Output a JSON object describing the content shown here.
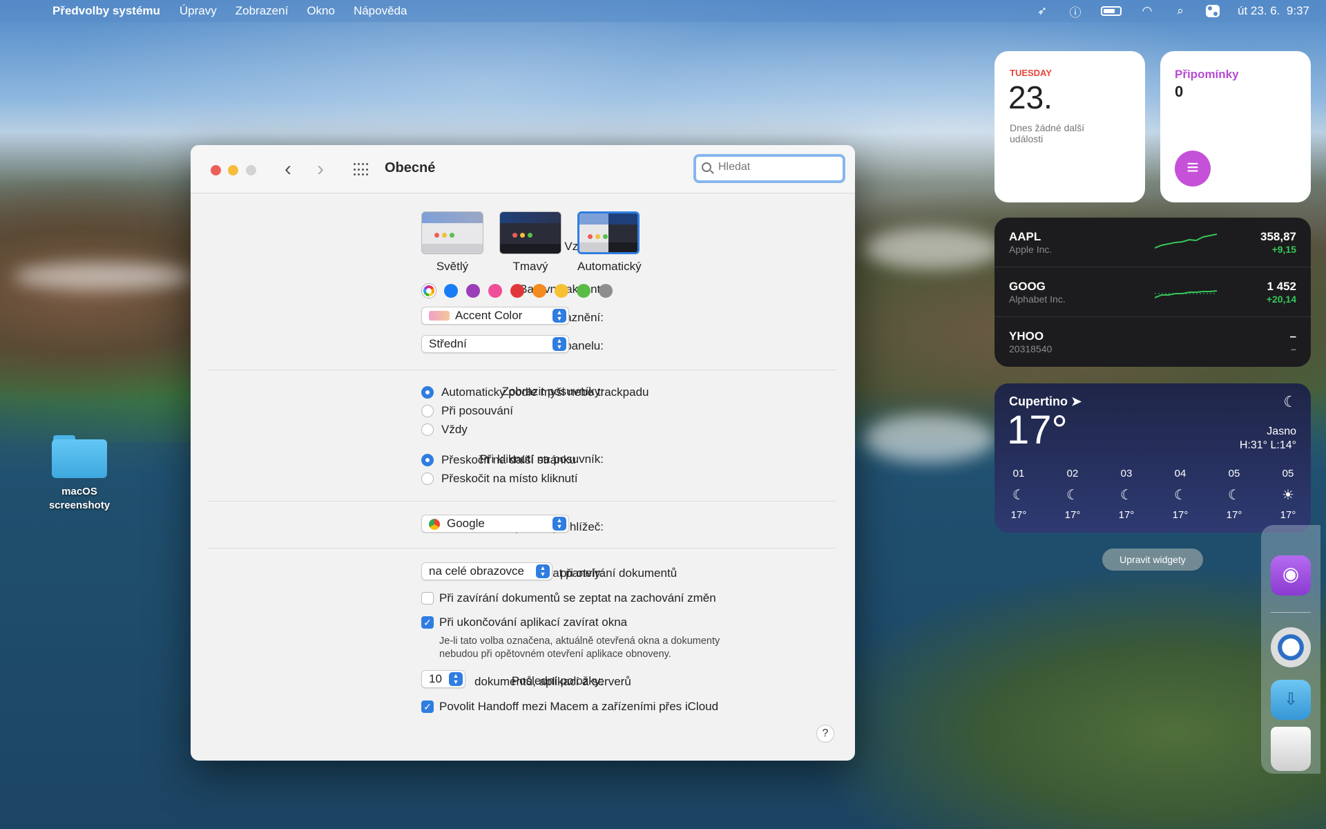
{
  "menubar": {
    "app": "Předvolby systému",
    "items": [
      "Úpravy",
      "Zobrazení",
      "Okno",
      "Nápověda"
    ],
    "datetime": "út 23. 6.  9:37"
  },
  "desktop": {
    "folder_label": "macOS screenshoty"
  },
  "window": {
    "title": "Obecné",
    "search_placeholder": "Hledat",
    "appearance": {
      "label": "Vzhled:",
      "options": [
        "Světlý",
        "Tmavý",
        "Automatický"
      ],
      "selected": "Automatický"
    },
    "accent": {
      "label": "Barevný akcent:",
      "colors": [
        "multicolor",
        "#1a7cf5",
        "#9b3fb8",
        "#f04e98",
        "#e2373a",
        "#f58a1f",
        "#f7c133",
        "#5bbb47",
        "#8e8e8e"
      ]
    },
    "highlight": {
      "label": "Barva zvýraznění:",
      "value": "Accent Color"
    },
    "sidebar_icons": {
      "label": "Velikost ikon na bočním panelu:",
      "value": "Střední"
    },
    "scrollbars": {
      "label": "Zobrazit posuvníky:",
      "options": [
        "Automaticky podle myši nebo trackpadu",
        "Při posouvání",
        "Vždy"
      ],
      "selected": 0
    },
    "scroll_click": {
      "label": "Při kliknutí na posuvník:",
      "options": [
        "Přeskočit na další stránku",
        "Přeskočit na místo kliknutí"
      ],
      "selected": 0
    },
    "browser": {
      "label": "Výchozí prohlížeč:",
      "value": "Google"
    },
    "tabs": {
      "label": "Preferovat panely:",
      "value": "na celé obrazovce",
      "suffix": "při otvírání dokumentů"
    },
    "ask_save": {
      "label": "Při zavírání dokumentů se zeptat na zachování změn",
      "checked": false
    },
    "close_windows": {
      "label": "Při ukončování aplikací zavírat okna",
      "checked": true
    },
    "close_note_1": "Je-li tato volba označena, aktuálně otevřená okna a dokumenty",
    "close_note_2": "nebudou při opětovném otevření aplikace obnoveny.",
    "recent": {
      "label": "Poslední položky:",
      "value": "10",
      "suffix": "dokumentů, aplikací a serverů"
    },
    "handoff": {
      "label": "Povolit Handoff mezi Macem a zařízeními přes iCloud",
      "checked": true
    },
    "help": "?"
  },
  "widgets": {
    "calendar": {
      "day": "TUESDAY",
      "date": "23.",
      "text": "Dnes žádné další události"
    },
    "reminders": {
      "title": "Připomínky",
      "count": "0"
    },
    "stocks": [
      {
        "symbol": "AAPL",
        "name": "Apple Inc.",
        "price": "358,87",
        "change": "+9,15"
      },
      {
        "symbol": "GOOG",
        "name": "Alphabet Inc.",
        "price": "1 452",
        "change": "+20,14"
      },
      {
        "symbol": "YHOO",
        "name": "20318540",
        "price": "–",
        "change": "–"
      }
    ],
    "weather": {
      "city": "Cupertino",
      "temp": "17°",
      "condition": "Jasno",
      "hilo": "H:31° L:14°",
      "hours": [
        {
          "h": "01",
          "t": "17°"
        },
        {
          "h": "02",
          "t": "17°"
        },
        {
          "h": "03",
          "t": "17°"
        },
        {
          "h": "04",
          "t": "17°"
        },
        {
          "h": "05",
          "t": "17°"
        },
        {
          "h": "05",
          "t": "17°"
        }
      ]
    },
    "edit_button": "Upravit widgety"
  }
}
